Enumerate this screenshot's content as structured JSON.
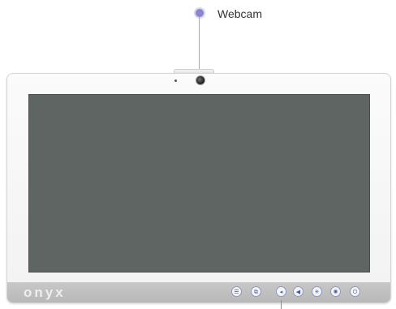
{
  "callout": {
    "label": "Webcam"
  },
  "device": {
    "brand": "onyx",
    "buttons": [
      {
        "name": "menu-button",
        "glyph": "☰"
      },
      {
        "name": "input-select-button",
        "glyph": "⧉"
      },
      {
        "name": "volume-down-button",
        "glyph": "◂"
      },
      {
        "name": "volume-up-button",
        "glyph": "◀"
      },
      {
        "name": "brightness-down-button",
        "glyph": "✳"
      },
      {
        "name": "brightness-up-button",
        "glyph": "✺"
      },
      {
        "name": "power-button",
        "glyph": "⏻"
      }
    ]
  },
  "colors": {
    "screen": "#5f6563",
    "accent": "#8a86cc",
    "chin": "#bdbdbd"
  }
}
